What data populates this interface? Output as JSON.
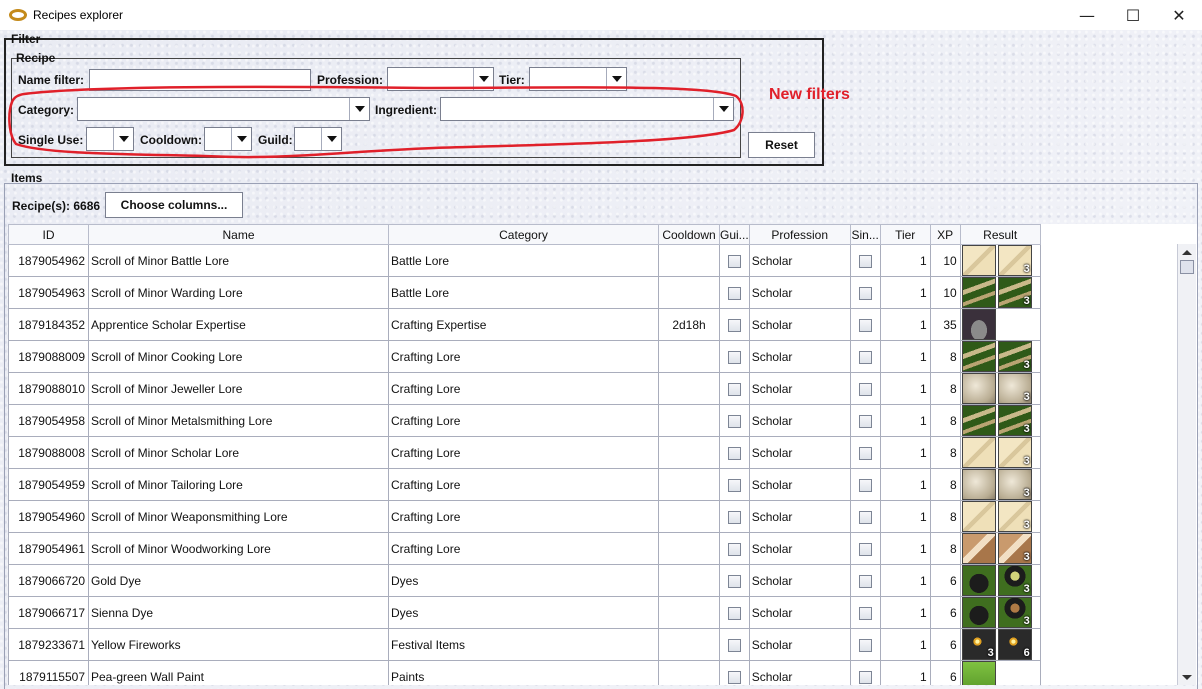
{
  "window": {
    "title": "Recipes explorer",
    "minimize_glyph": "—",
    "maximize_glyph": "☐",
    "close_glyph": "✕"
  },
  "filter": {
    "legend": "Filter",
    "recipe_legend": "Recipe",
    "name_filter_label": "Name filter:",
    "name_filter_value": "",
    "profession_label": "Profession:",
    "tier_label": "Tier:",
    "category_label": "Category:",
    "ingredient_label": "Ingredient:",
    "single_use_label": "Single Use:",
    "cooldown_label": "Cooldown:",
    "guild_label": "Guild:",
    "reset_label": "Reset"
  },
  "annotation": {
    "text": "New filters",
    "color": "#e0202a"
  },
  "items": {
    "legend": "Items",
    "count_text": "Recipe(s): 6686",
    "choose_columns_label": "Choose columns..."
  },
  "table": {
    "columns": [
      "ID",
      "Name",
      "Category",
      "Cooldown",
      "Gui...",
      "Profession",
      "Sin...",
      "Tier",
      "XP",
      "Result"
    ],
    "rows": [
      {
        "id": "1879054962",
        "name": "Scroll of Minor Battle Lore",
        "category": "Battle Lore",
        "cooldown": "",
        "profession": "Scholar",
        "tier": "1",
        "xp": "10",
        "results": [
          {
            "icon": "parchment-icon",
            "count": ""
          },
          {
            "icon": "parchment-icon",
            "count": "3"
          }
        ]
      },
      {
        "id": "1879054963",
        "name": "Scroll of Minor Warding Lore",
        "category": "Battle Lore",
        "cooldown": "",
        "profession": "Scholar",
        "tier": "1",
        "xp": "10",
        "results": [
          {
            "icon": "scroll-green-icon",
            "count": ""
          },
          {
            "icon": "scroll-green-icon",
            "count": "3"
          }
        ]
      },
      {
        "id": "1879184352",
        "name": "Apprentice Scholar Expertise",
        "category": "Crafting Expertise",
        "cooldown": "2d18h",
        "profession": "Scholar",
        "tier": "1",
        "xp": "35",
        "results": [
          {
            "icon": "dust-pile-icon",
            "count": ""
          }
        ]
      },
      {
        "id": "1879088009",
        "name": "Scroll of Minor Cooking Lore",
        "category": "Crafting Lore",
        "cooldown": "",
        "profession": "Scholar",
        "tier": "1",
        "xp": "8",
        "results": [
          {
            "icon": "scroll-green-icon",
            "count": ""
          },
          {
            "icon": "scroll-green-icon",
            "count": "3"
          }
        ]
      },
      {
        "id": "1879088010",
        "name": "Scroll of Minor Jeweller Lore",
        "category": "Crafting Lore",
        "cooldown": "",
        "profession": "Scholar",
        "tier": "1",
        "xp": "8",
        "results": [
          {
            "icon": "stone-scroll-icon",
            "count": ""
          },
          {
            "icon": "stone-scroll-icon",
            "count": "3"
          }
        ]
      },
      {
        "id": "1879054958",
        "name": "Scroll of Minor Metalsmithing Lore",
        "category": "Crafting Lore",
        "cooldown": "",
        "profession": "Scholar",
        "tier": "1",
        "xp": "8",
        "results": [
          {
            "icon": "scroll-green-icon",
            "count": ""
          },
          {
            "icon": "scroll-green-icon",
            "count": "3"
          }
        ]
      },
      {
        "id": "1879088008",
        "name": "Scroll of Minor Scholar Lore",
        "category": "Crafting Lore",
        "cooldown": "",
        "profession": "Scholar",
        "tier": "1",
        "xp": "8",
        "results": [
          {
            "icon": "parchment-icon",
            "count": ""
          },
          {
            "icon": "parchment-icon",
            "count": "3"
          }
        ]
      },
      {
        "id": "1879054959",
        "name": "Scroll of Minor Tailoring Lore",
        "category": "Crafting Lore",
        "cooldown": "",
        "profession": "Scholar",
        "tier": "1",
        "xp": "8",
        "results": [
          {
            "icon": "stone-scroll-icon",
            "count": ""
          },
          {
            "icon": "stone-scroll-icon",
            "count": "3"
          }
        ]
      },
      {
        "id": "1879054960",
        "name": "Scroll of Minor Weaponsmithing Lore",
        "category": "Crafting Lore",
        "cooldown": "",
        "profession": "Scholar",
        "tier": "1",
        "xp": "8",
        "results": [
          {
            "icon": "parchment-icon",
            "count": ""
          },
          {
            "icon": "parchment-icon",
            "count": "3"
          }
        ]
      },
      {
        "id": "1879054961",
        "name": "Scroll of Minor Woodworking Lore",
        "category": "Crafting Lore",
        "cooldown": "",
        "profession": "Scholar",
        "tier": "1",
        "xp": "8",
        "results": [
          {
            "icon": "book-icon",
            "count": ""
          },
          {
            "icon": "book-icon",
            "count": "3"
          }
        ]
      },
      {
        "id": "1879066720",
        "name": "Gold Dye",
        "category": "Dyes",
        "cooldown": "",
        "profession": "Scholar",
        "tier": "1",
        "xp": "6",
        "results": [
          {
            "icon": "dye-pot-icon",
            "count": ""
          },
          {
            "icon": "dye-pot-gold-icon",
            "count": "3"
          }
        ]
      },
      {
        "id": "1879066717",
        "name": "Sienna Dye",
        "category": "Dyes",
        "cooldown": "",
        "profession": "Scholar",
        "tier": "1",
        "xp": "6",
        "results": [
          {
            "icon": "dye-pot-icon",
            "count": ""
          },
          {
            "icon": "dye-pot-sienna-icon",
            "count": "3"
          }
        ]
      },
      {
        "id": "1879233671",
        "name": "Yellow Fireworks",
        "category": "Festival Items",
        "cooldown": "",
        "profession": "Scholar",
        "tier": "1",
        "xp": "6",
        "results": [
          {
            "icon": "firework-icon",
            "count": "3"
          },
          {
            "icon": "firework-icon",
            "count": "6"
          }
        ]
      },
      {
        "id": "1879115507",
        "name": "Pea-green Wall Paint",
        "category": "Paints",
        "cooldown": "",
        "profession": "Scholar",
        "tier": "1",
        "xp": "6",
        "results": [
          {
            "icon": "paint-green-icon",
            "count": ""
          }
        ]
      }
    ]
  }
}
